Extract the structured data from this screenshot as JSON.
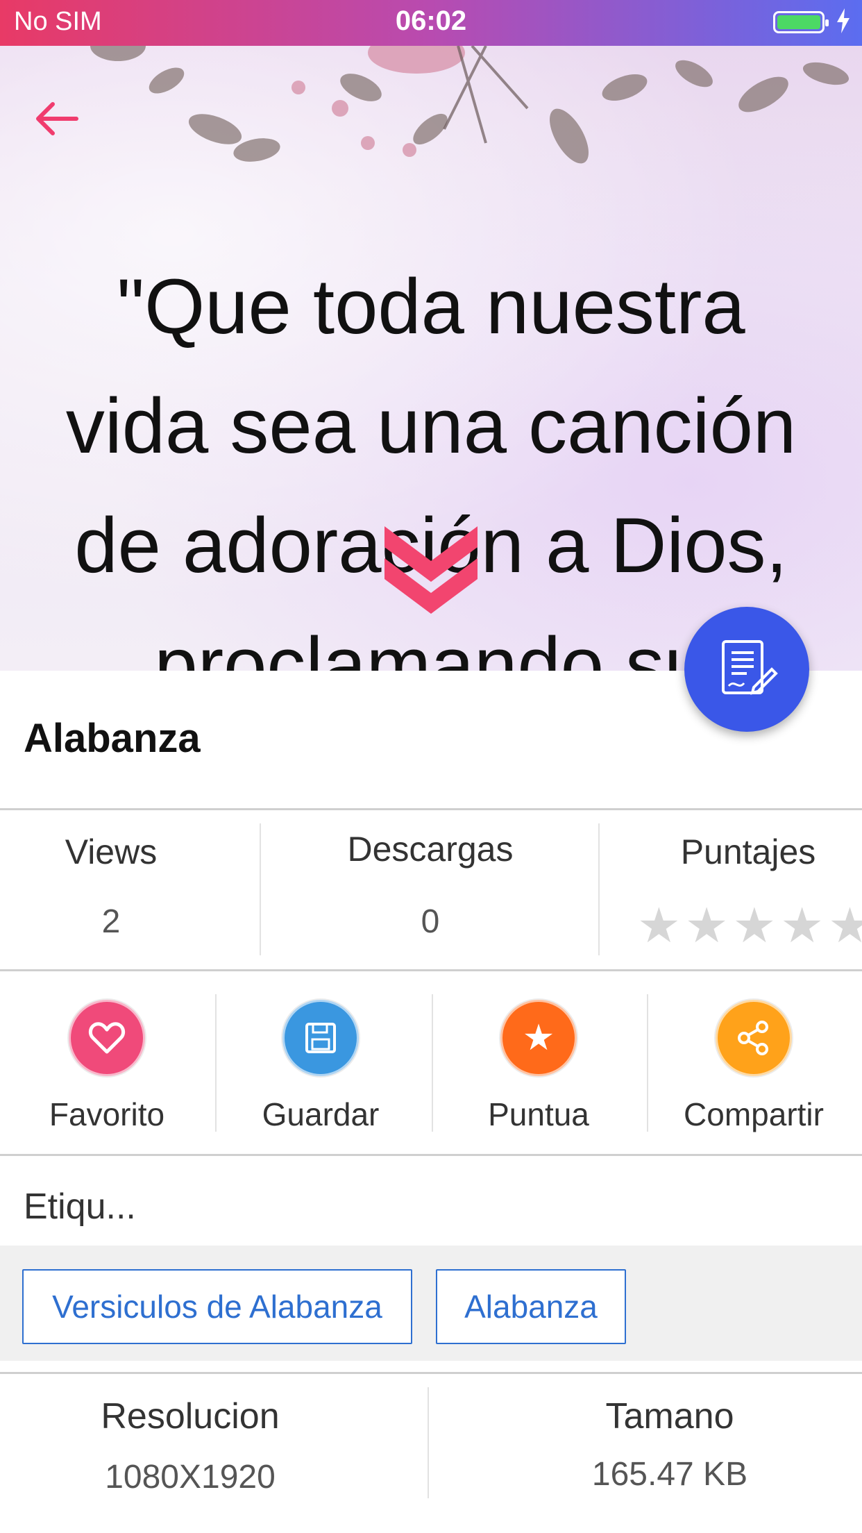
{
  "status_bar": {
    "carrier": "No SIM",
    "time": "06:02"
  },
  "hero": {
    "quote_lines": [
      "\"Que toda nuestra",
      "vida sea una canción",
      "de adoración a Dios,",
      "proclamando su"
    ]
  },
  "title": "Alabanza",
  "stats": {
    "views": {
      "label": "Views",
      "value": "2"
    },
    "downloads": {
      "label": "Descargas",
      "value": "0"
    },
    "rating": {
      "label": "Puntajes",
      "stars_filled": 0,
      "stars_total": 5
    }
  },
  "actions": [
    {
      "label": "Favorito",
      "icon": "heart-icon",
      "color": "#f04a7a"
    },
    {
      "label": "Guardar",
      "icon": "save-icon",
      "color": "#3a97e0"
    },
    {
      "label": "Puntua",
      "icon": "star-icon",
      "color": "#ff6a1a"
    },
    {
      "label": "Compartir",
      "icon": "share-icon",
      "color": "#ffa21a"
    }
  ],
  "tags": {
    "heading": "Etiqu...",
    "items": [
      "Versiculos de Alabanza",
      "Alabanza"
    ]
  },
  "details": {
    "resolution": {
      "label": "Resolucion",
      "value": "1080X1920"
    },
    "size": {
      "label": "Tamano",
      "value": "165.47 KB"
    }
  },
  "colors": {
    "accent": "#3a57e8",
    "brand_pink": "#f04a7a",
    "link_blue": "#2e6fd0"
  }
}
